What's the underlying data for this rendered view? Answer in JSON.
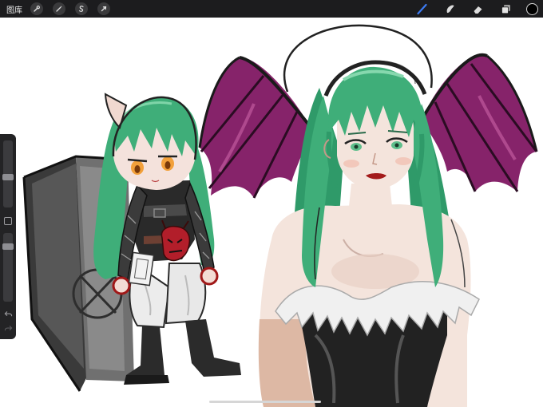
{
  "toolbar": {
    "gallery_label": "图库",
    "left_tools": [
      {
        "name": "actions",
        "icon": "wrench-icon"
      },
      {
        "name": "adjustments",
        "icon": "magic-wand-icon"
      },
      {
        "name": "selection",
        "icon": "selection-s-icon"
      },
      {
        "name": "transform",
        "icon": "arrow-cursor-icon"
      }
    ],
    "right_tools": [
      {
        "name": "brush",
        "icon": "brush-icon",
        "active": true
      },
      {
        "name": "smudge",
        "icon": "smudge-icon"
      },
      {
        "name": "eraser",
        "icon": "eraser-icon"
      },
      {
        "name": "layers",
        "icon": "layers-icon"
      }
    ],
    "active_tool_color": "#3d7cf5",
    "current_color": "#000000"
  },
  "sidebar": {
    "brush_size": 0.45,
    "opacity": 0.2
  },
  "colors": {
    "hair": "#3fae79",
    "wings": "#86236a",
    "skin": "#f2ddd5",
    "outline": "#1a1a1a"
  }
}
